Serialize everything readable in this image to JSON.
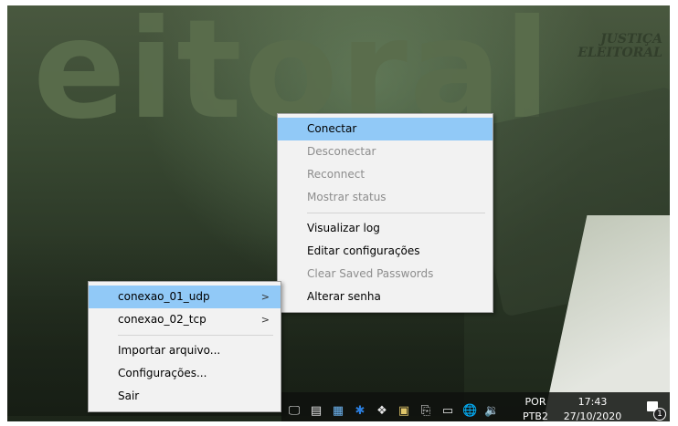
{
  "wallpaper": {
    "big_text": "eitoral",
    "small_text_line1": "JUSTIÇA",
    "small_text_line2": "ELEITORAL"
  },
  "submenu": {
    "items": [
      {
        "label": "Conectar",
        "state": "highlighted"
      },
      {
        "label": "Desconectar",
        "state": "disabled"
      },
      {
        "label": "Reconnect",
        "state": "disabled"
      },
      {
        "label": "Mostrar status",
        "state": "disabled"
      },
      {
        "label": "Visualizar log",
        "state": "enabled"
      },
      {
        "label": "Editar configurações",
        "state": "enabled"
      },
      {
        "label": "Clear Saved Passwords",
        "state": "disabled"
      },
      {
        "label": "Alterar senha",
        "state": "enabled"
      }
    ]
  },
  "main_menu": {
    "items": [
      {
        "label": "conexao_01_udp",
        "arrow": ">"
      },
      {
        "label": "conexao_02_tcp",
        "arrow": ">"
      },
      {
        "label": "Importar arquivo..."
      },
      {
        "label": "Configurações..."
      },
      {
        "label": "Sair"
      }
    ]
  },
  "tray": {
    "language": "POR",
    "layout": "PTB2",
    "time": "17:43",
    "date": "27/10/2020",
    "notification_count": "1",
    "colors": {
      "highlight": "#91c9f7",
      "menu_bg": "#f2f2f2",
      "disabled_text": "#8d8d8d"
    }
  }
}
